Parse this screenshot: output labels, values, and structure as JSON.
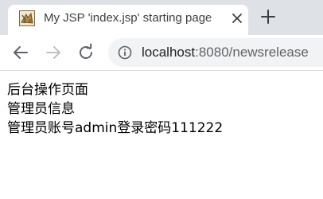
{
  "browser": {
    "tab": {
      "title": "My JSP 'index.jsp' starting page",
      "favicon": "jsp-page-icon"
    },
    "toolbar": {
      "url_host": "localhost",
      "url_rest": ":8080/newsrelease",
      "icons": [
        "back-arrow-icon",
        "forward-arrow-icon",
        "reload-icon",
        "site-info-icon"
      ]
    },
    "colors": {
      "tabstrip": "#dee1e6",
      "omnibox": "#f1f3f4"
    }
  },
  "page": {
    "heading": "后台操作页面",
    "section_title": "管理员信息",
    "admin_info": "管理员账号admin登录密码111222"
  }
}
